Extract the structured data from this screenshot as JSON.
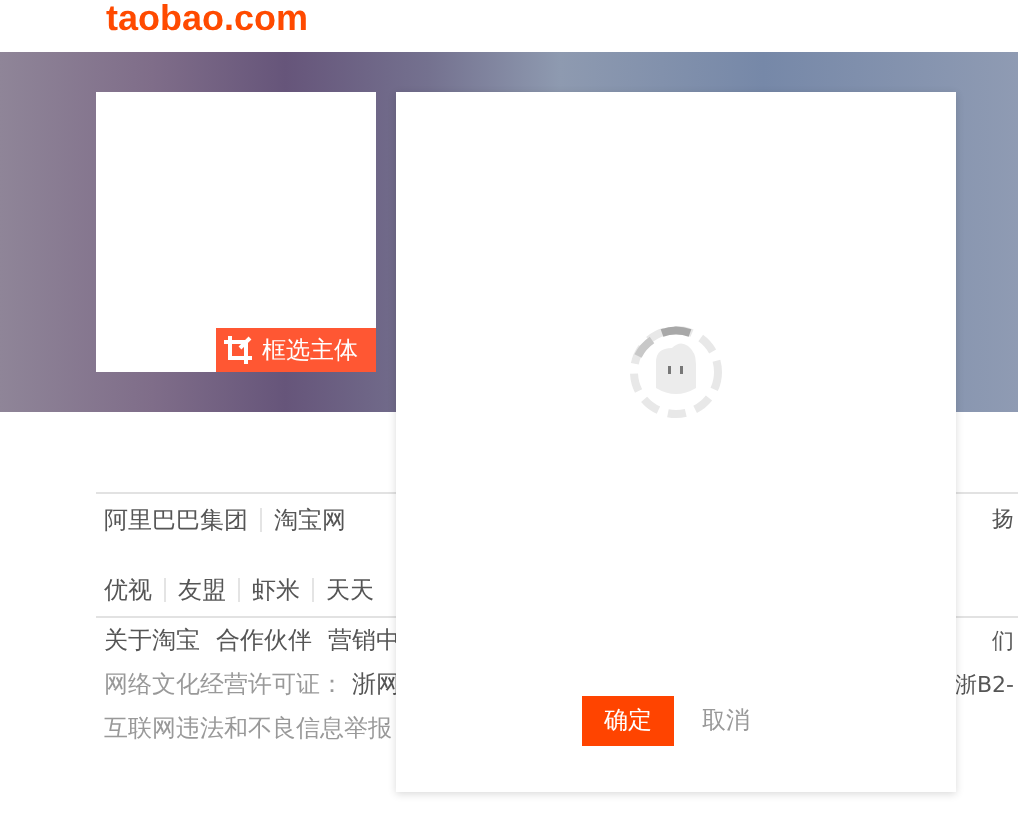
{
  "logo": {
    "text": "taobao.com"
  },
  "image_panel": {
    "crop_button": {
      "label": "框选主体"
    }
  },
  "dialog": {
    "buttons": [
      {
        "label": "确定",
        "kind": "primary"
      },
      {
        "label": "取消",
        "kind": "secondary"
      }
    ]
  },
  "footer": {
    "rows": [
      {
        "kind": "links",
        "left": [
          {
            "text": "阿里巴巴集团",
            "muted": false
          },
          {
            "text": "淘宝网",
            "muted": false
          }
        ],
        "right": [
          {
            "text": "扬",
            "muted": false
          }
        ]
      },
      {
        "kind": "links",
        "left": [
          {
            "text": "优视",
            "muted": false
          },
          {
            "text": "友盟",
            "muted": false
          },
          {
            "text": "虾米",
            "muted": false
          },
          {
            "text": "天天",
            "muted": false
          }
        ],
        "right": []
      },
      {
        "kind": "plain",
        "left": [
          {
            "text": "关于淘宝",
            "muted": false
          },
          {
            "text": "合作伙伴",
            "muted": false
          },
          {
            "text": "营销中",
            "muted": false
          }
        ],
        "right": [
          {
            "text": "们",
            "muted": false
          }
        ]
      },
      {
        "kind": "plain",
        "left": [
          {
            "text": "网络文化经营许可证：",
            "muted": true
          },
          {
            "text": "浙网",
            "muted": false
          }
        ],
        "right": [
          {
            "text": "浙B2-",
            "muted": false
          }
        ]
      },
      {
        "kind": "plain",
        "left": [
          {
            "text": "互联网违法和不良信息举报",
            "muted": true
          }
        ],
        "right": []
      }
    ]
  }
}
